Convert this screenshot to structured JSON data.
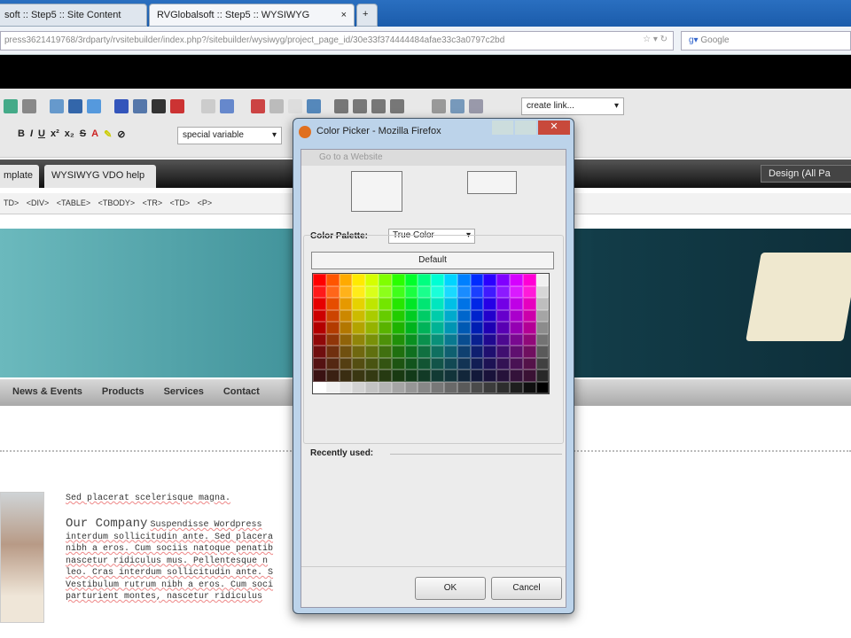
{
  "browser": {
    "tabs": [
      {
        "label": "soft :: Step5 :: Site Content"
      },
      {
        "label": "RVGlobalsoft :: Step5 :: WYSIWYG"
      }
    ],
    "new_tab": "+",
    "url": "press3621419768/3rdparty/rvsitebuilder/index.php?/sitebuilder/wysiwyg/project_page_id/30e33f374444484afae33c3a0797c2bd",
    "search_placeholder": "Google"
  },
  "editor": {
    "link_select": "create link...",
    "variable_select": "special variable",
    "tabs": [
      {
        "label": "mplate"
      },
      {
        "label": "WYSIWYG VDO help"
      }
    ],
    "design_button": "Design (All Pa",
    "breadcrumb": "TD> <DIV> <TABLE> <TBODY> <TR> <TD> <P>"
  },
  "site": {
    "nav": [
      "News & Events",
      "Products",
      "Services",
      "Contact"
    ],
    "headline": "Sed placerat scelerisque magna.",
    "company_title": "Our Company",
    "paragraph_lines": [
      "Suspendisse Wordpress",
      "interdum sollicitudin ante. Sed placera",
      "nibh a eros. Cum sociis natoque penatib",
      "nascetur ridiculus mus. Pellentesque n",
      "leo. Cras interdum sollicitudin ante. S",
      "Vestibulum rutrum nibh a eros. Cum soci",
      "parturient montes, nascetur ridiculus"
    ]
  },
  "dialog": {
    "title": "Color Picker - Mozilla Firefox",
    "goto": "Go to a Website",
    "palette_label": "Color Palette:",
    "palette_select": "True Color",
    "default_button": "Default",
    "recently_used": "Recently used:",
    "ok": "OK",
    "cancel": "Cancel"
  },
  "palette": {
    "hues": [
      0,
      20,
      40,
      55,
      70,
      90,
      110,
      130,
      150,
      170,
      190,
      210,
      230,
      250,
      270,
      290,
      310,
      330
    ]
  }
}
